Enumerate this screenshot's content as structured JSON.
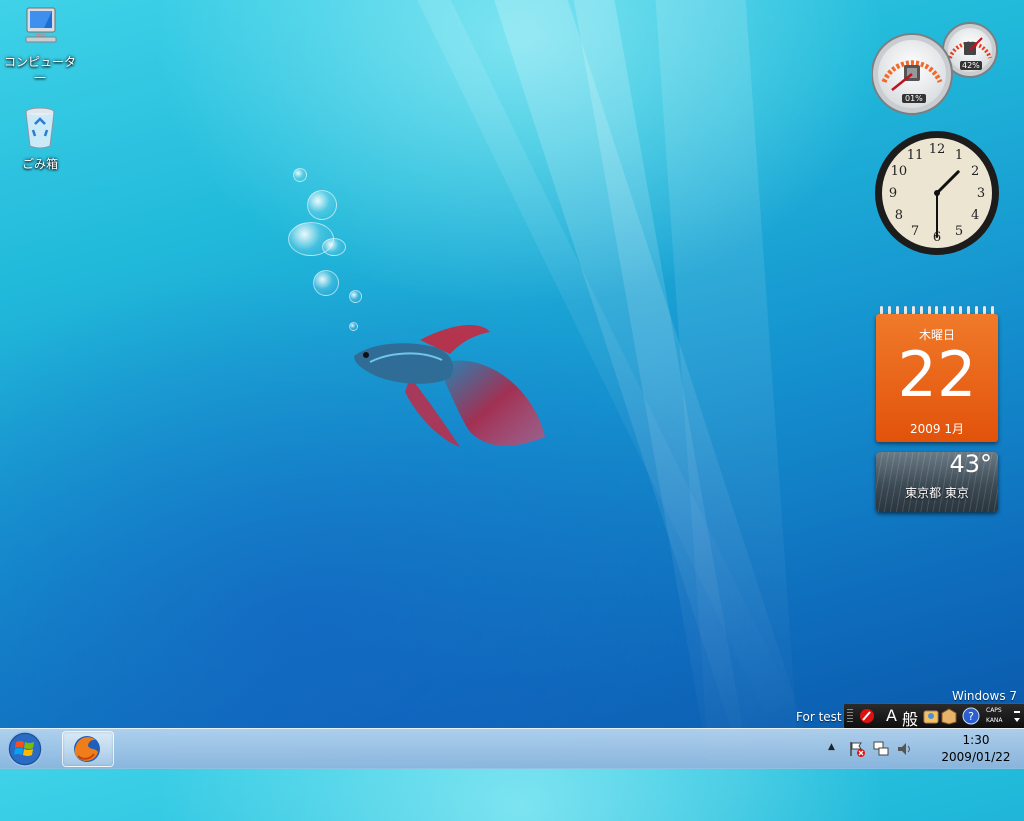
{
  "desktop": {
    "icons": [
      {
        "label": "コンピュータ\n—"
      },
      {
        "label": "ごみ箱"
      }
    ]
  },
  "gadgets": {
    "cpu_meter": {
      "cpu_label": "01%",
      "memory_label": "42%"
    },
    "clock": {
      "numerals": [
        "12",
        "1",
        "2",
        "3",
        "4",
        "5",
        "6",
        "7",
        "8",
        "9",
        "10",
        "11"
      ],
      "hour": 1,
      "minute": 30
    },
    "calendar": {
      "weekday": "木曜日",
      "day": "22",
      "year_month": "2009 1月"
    },
    "weather": {
      "temperature": "43°",
      "location": "東京都 東京"
    }
  },
  "watermark": {
    "line1": "Windows 7",
    "line2": "For test"
  },
  "langbar": {
    "mode": "A",
    "ime": "般",
    "caps": "CAPS",
    "kana": "KANA"
  },
  "taskbar": {
    "clock_time": "1:30",
    "clock_date": "2009/01/22"
  },
  "colors": {
    "accent": "#e2520b",
    "taskbar": "#b7d3ec"
  }
}
